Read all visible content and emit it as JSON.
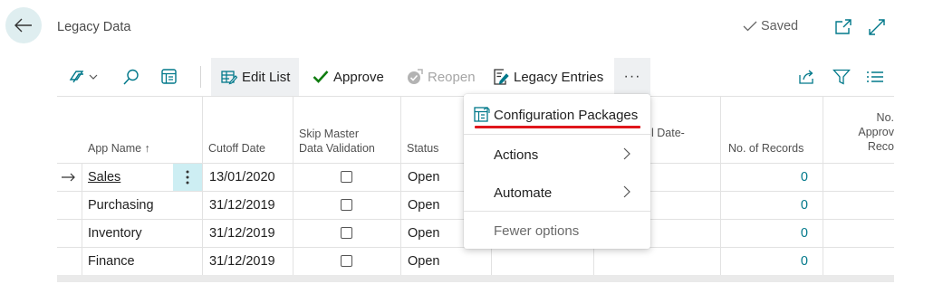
{
  "header": {
    "title": "Legacy Data",
    "saved_label": "Saved"
  },
  "toolbar": {
    "edit_list": "Edit List",
    "approve": "Approve",
    "reopen": "Reopen",
    "legacy_entries": "Legacy Entries",
    "more": "···"
  },
  "table": {
    "headers": {
      "app_name": "App Name ↑",
      "cutoff_date": "Cutoff Date",
      "skip_master_1": "Skip Master",
      "skip_master_2": "Data Validation",
      "status": "Status",
      "hidden_col": "l Date-",
      "no_records": "No. of Records",
      "approved_1": "No.",
      "approved_2": "Approv",
      "approved_3": "Reco"
    },
    "rows": [
      {
        "app_name": "Sales",
        "cutoff": "13/01/2020",
        "status": "Open",
        "records": "0"
      },
      {
        "app_name": "Purchasing",
        "cutoff": "31/12/2019",
        "status": "Open",
        "records": "0"
      },
      {
        "app_name": "Inventory",
        "cutoff": "31/12/2019",
        "status": "Open",
        "records": "0"
      },
      {
        "app_name": "Finance",
        "cutoff": "31/12/2019",
        "status": "Open",
        "records": "0"
      }
    ]
  },
  "menu": {
    "config_packages": "Configuration Packages",
    "actions": "Actions",
    "automate": "Automate",
    "fewer_options": "Fewer options"
  },
  "colors": {
    "accent": "#00788a",
    "highlight": "#e0161b",
    "row_action_bg": "#cdeef3"
  }
}
